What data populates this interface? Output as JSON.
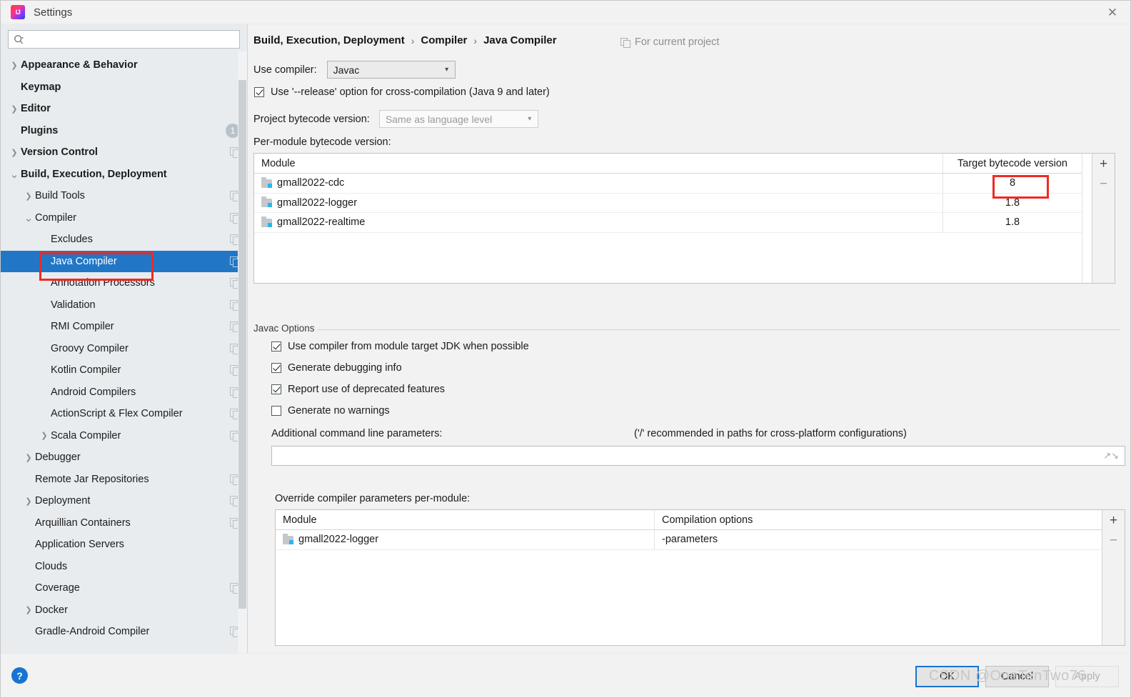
{
  "window": {
    "title": "Settings",
    "app_icon": "intellij-idea-icon",
    "close_label": "✕"
  },
  "sidebar": {
    "search": {
      "placeholder": "",
      "value": "",
      "icon": "search-icon"
    },
    "items": [
      {
        "label": "Appearance & Behavior",
        "level": 0,
        "bold": true,
        "twisty": "collapsed",
        "cfg": false,
        "badge": ""
      },
      {
        "label": "Keymap",
        "level": 0,
        "bold": true,
        "twisty": "none",
        "cfg": false,
        "badge": ""
      },
      {
        "label": "Editor",
        "level": 0,
        "bold": true,
        "twisty": "collapsed",
        "cfg": false,
        "badge": ""
      },
      {
        "label": "Plugins",
        "level": 0,
        "bold": true,
        "twisty": "none",
        "cfg": false,
        "badge": "1"
      },
      {
        "label": "Version Control",
        "level": 0,
        "bold": true,
        "twisty": "collapsed",
        "cfg": true,
        "badge": ""
      },
      {
        "label": "Build, Execution, Deployment",
        "level": 0,
        "bold": true,
        "twisty": "expanded",
        "cfg": false,
        "badge": ""
      },
      {
        "label": "Build Tools",
        "level": 1,
        "bold": false,
        "twisty": "collapsed",
        "cfg": true,
        "badge": ""
      },
      {
        "label": "Compiler",
        "level": 1,
        "bold": false,
        "twisty": "expanded",
        "cfg": true,
        "badge": ""
      },
      {
        "label": "Excludes",
        "level": 2,
        "bold": false,
        "twisty": "none",
        "cfg": true,
        "badge": ""
      },
      {
        "label": "Java Compiler",
        "level": 2,
        "bold": false,
        "twisty": "none",
        "cfg": true,
        "badge": "",
        "selected": true
      },
      {
        "label": "Annotation Processors",
        "level": 2,
        "bold": false,
        "twisty": "none",
        "cfg": true,
        "badge": ""
      },
      {
        "label": "Validation",
        "level": 2,
        "bold": false,
        "twisty": "none",
        "cfg": true,
        "badge": ""
      },
      {
        "label": "RMI Compiler",
        "level": 2,
        "bold": false,
        "twisty": "none",
        "cfg": true,
        "badge": ""
      },
      {
        "label": "Groovy Compiler",
        "level": 2,
        "bold": false,
        "twisty": "none",
        "cfg": true,
        "badge": ""
      },
      {
        "label": "Kotlin Compiler",
        "level": 2,
        "bold": false,
        "twisty": "none",
        "cfg": true,
        "badge": ""
      },
      {
        "label": "Android Compilers",
        "level": 2,
        "bold": false,
        "twisty": "none",
        "cfg": true,
        "badge": ""
      },
      {
        "label": "ActionScript & Flex Compiler",
        "level": 2,
        "bold": false,
        "twisty": "none",
        "cfg": true,
        "badge": ""
      },
      {
        "label": "Scala Compiler",
        "level": 2,
        "bold": false,
        "twisty": "collapsed",
        "cfg": true,
        "badge": ""
      },
      {
        "label": "Debugger",
        "level": 1,
        "bold": false,
        "twisty": "collapsed",
        "cfg": false,
        "badge": ""
      },
      {
        "label": "Remote Jar Repositories",
        "level": 1,
        "bold": false,
        "twisty": "none",
        "cfg": true,
        "badge": ""
      },
      {
        "label": "Deployment",
        "level": 1,
        "bold": false,
        "twisty": "collapsed",
        "cfg": true,
        "badge": ""
      },
      {
        "label": "Arquillian Containers",
        "level": 1,
        "bold": false,
        "twisty": "none",
        "cfg": true,
        "badge": ""
      },
      {
        "label": "Application Servers",
        "level": 1,
        "bold": false,
        "twisty": "none",
        "cfg": false,
        "badge": ""
      },
      {
        "label": "Clouds",
        "level": 1,
        "bold": false,
        "twisty": "none",
        "cfg": false,
        "badge": ""
      },
      {
        "label": "Coverage",
        "level": 1,
        "bold": false,
        "twisty": "none",
        "cfg": true,
        "badge": ""
      },
      {
        "label": "Docker",
        "level": 1,
        "bold": false,
        "twisty": "collapsed",
        "cfg": false,
        "badge": ""
      },
      {
        "label": "Gradle-Android Compiler",
        "level": 1,
        "bold": false,
        "twisty": "none",
        "cfg": true,
        "badge": ""
      }
    ]
  },
  "main": {
    "breadcrumb": [
      "Build, Execution, Deployment",
      "Compiler",
      "Java Compiler"
    ],
    "breadcrumb_sep": "›",
    "for_current_project": "For current project",
    "use_compiler_label": "Use compiler:",
    "use_compiler_value": "Javac",
    "release_option_label": "Use '--release' option for cross-compilation (Java 9 and later)",
    "release_option_checked": true,
    "project_bytecode_label": "Project bytecode version:",
    "project_bytecode_value": "Same as language level",
    "per_module_label": "Per-module bytecode version:",
    "per_module_table": {
      "columns": [
        "Module",
        "Target bytecode version"
      ],
      "rows": [
        {
          "module": "gmall2022-cdc",
          "version": "8",
          "highlighted": true
        },
        {
          "module": "gmall2022-logger",
          "version": "1.8",
          "highlighted": false
        },
        {
          "module": "gmall2022-realtime",
          "version": "1.8",
          "highlighted": false
        }
      ],
      "add_label": "+",
      "remove_label": "−"
    },
    "javac_options_legend": "Javac Options",
    "javac_checkboxes": [
      {
        "label": "Use compiler from module target JDK when possible",
        "checked": true
      },
      {
        "label": "Generate debugging info",
        "checked": true
      },
      {
        "label": "Report use of deprecated features",
        "checked": true
      },
      {
        "label": "Generate no warnings",
        "checked": false
      }
    ],
    "additional_params_label": "Additional command line parameters:",
    "additional_params_hint": "('/' recommended in paths for cross-platform configurations)",
    "additional_params_value": "",
    "override_label": "Override compiler parameters per-module:",
    "override_table": {
      "columns": [
        "Module",
        "Compilation options"
      ],
      "rows": [
        {
          "module": "gmall2022-logger",
          "options": "-parameters"
        }
      ],
      "add_label": "+",
      "remove_label": "−"
    }
  },
  "footer": {
    "help_label": "?",
    "buttons": [
      {
        "label": "OK",
        "style": "default"
      },
      {
        "label": "Cancel",
        "style": "normal"
      },
      {
        "label": "Apply",
        "style": "disabled"
      }
    ]
  },
  "watermark": "CSDN @OneTenTwo76",
  "colors": {
    "selection": "#2177c6",
    "annotation": "#ee2a21",
    "accent": "#1675d1",
    "sidebar_bg": "#e8ecef",
    "panel_bg": "#f2f2f2"
  }
}
